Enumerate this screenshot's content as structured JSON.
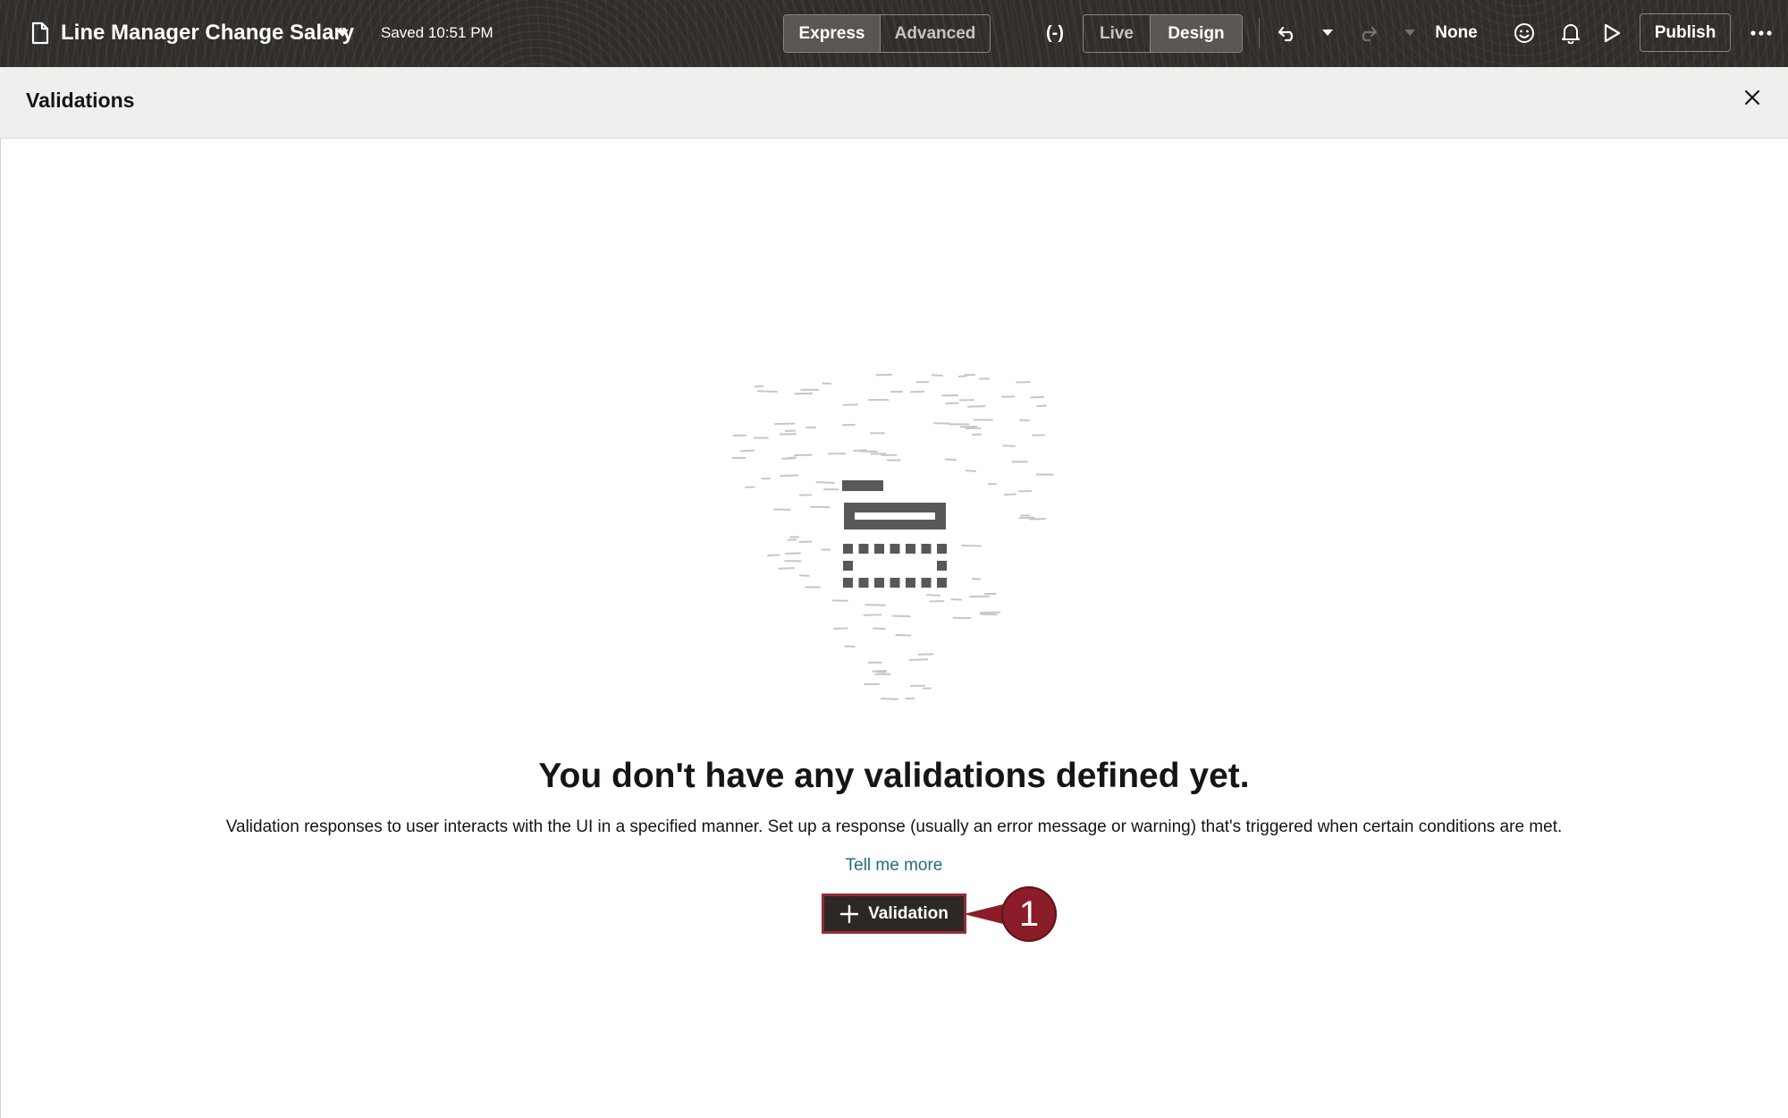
{
  "header": {
    "app_title": "Line Manager Change Salary",
    "saved_status": "Saved 10:51 PM",
    "mode_options": [
      "Express",
      "Advanced"
    ],
    "selected_mode": "Express",
    "expression_icon_label": "(-)",
    "view_options": [
      "Live",
      "Design"
    ],
    "selected_view": "Design",
    "sandbox_label": "None",
    "publish_label": "Publish",
    "icons": {
      "document": "document-icon",
      "title_dropdown": "caret-down-icon",
      "undo": "undo-icon",
      "redo": "redo-icon",
      "feedback": "smiley-icon",
      "notifications": "bell-icon",
      "preview": "play-icon",
      "more": "more-horizontal-icon"
    }
  },
  "panel": {
    "title": "Validations",
    "close_icon": "close-icon"
  },
  "empty_state": {
    "heading": "You don't have any validations defined yet.",
    "description": "Validation responses to user interacts with the UI in a specified manner. Set up a response (usually an error message or warning) that's triggered when certain conditions are met.",
    "link": "Tell me more",
    "add_button_label": "Validation",
    "illustration": "form-validation-illustration"
  },
  "annotation": {
    "callout_number": "1",
    "color": "#8a1d27"
  },
  "colors": {
    "header_bg": "#312d2a",
    "panel_header_bg": "#f1efed",
    "link": "#1f6c86",
    "button_bg": "#2b2826"
  }
}
